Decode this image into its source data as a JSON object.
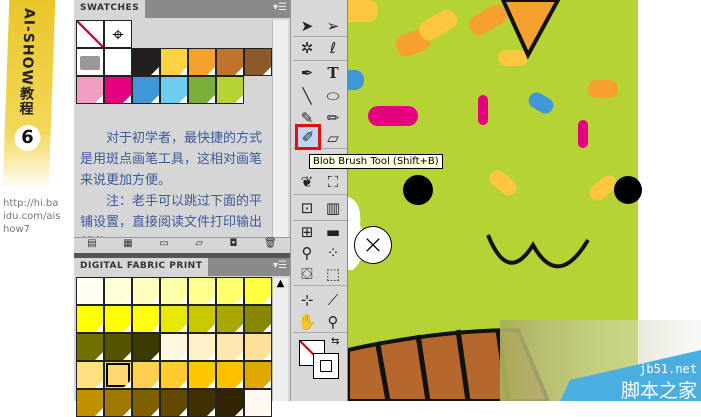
{
  "branding": {
    "series": "AI-SHOW教程",
    "episode": "6",
    "url": "http://hi.baidu.com/aishow7"
  },
  "swatches_panel": {
    "title": "SWATCHES",
    "menu_icon": "panel-menu-icon",
    "row1": [
      "none",
      "registration"
    ],
    "row2": [
      "folder",
      "#ffffff",
      "#231f20",
      "#fdd343",
      "#f6a12e",
      "#c0742b",
      "#8b5a2b"
    ],
    "row3": [
      "#f19ec2",
      "#e4007f",
      "#3f97d8",
      "#6dcdf0",
      "#7aaf3b",
      "#b5d334"
    ],
    "note": [
      "对于初学者，最快捷的方式是用斑点画笔工具，这相对画笔来说更加方便。",
      "注：老手可以跳过下面的平铺设置，直接阅读文件打印输出部分。"
    ],
    "bottom_icons": [
      "swatch-libraries-icon",
      "show-kinds-icon",
      "swatch-options-icon",
      "new-color-group-icon",
      "new-swatch-icon",
      "delete-swatch-icon"
    ]
  },
  "fabric_panel": {
    "title": "DIGITAL FABRIC PRINT",
    "rows": [
      [
        "#fffff0",
        "#ffffd8",
        "#ffffc0",
        "#ffffa8",
        "#ffff90",
        "#ffff70",
        "#ffff40"
      ],
      [
        "#ffff00",
        "#ffff00",
        "#ffff10",
        "#e8e800",
        "#c8c800",
        "#a8a800",
        "#888800"
      ],
      [
        "#707000",
        "#555500",
        "#3a3a00",
        "#fff8e0",
        "#fff0c8",
        "#ffe8b0",
        "#ffe098"
      ],
      [
        "#ffe080",
        "#ffd870",
        "#ffd050",
        "#ffcc30",
        "#ffc800",
        "#ffc000",
        "#e0a800"
      ],
      [
        "#c09000",
        "#a07800",
        "#806000",
        "#604800",
        "#403000",
        "#302400",
        "#fff8f0"
      ]
    ],
    "selected": [
      3,
      1
    ]
  },
  "tools": {
    "tooltip": "Blob Brush Tool (Shift+B)",
    "active": "blob-brush"
  },
  "canvas": {
    "bg": "#b5d334"
  },
  "watermark": {
    "site": "jb51.net",
    "name": "脚本之家"
  }
}
